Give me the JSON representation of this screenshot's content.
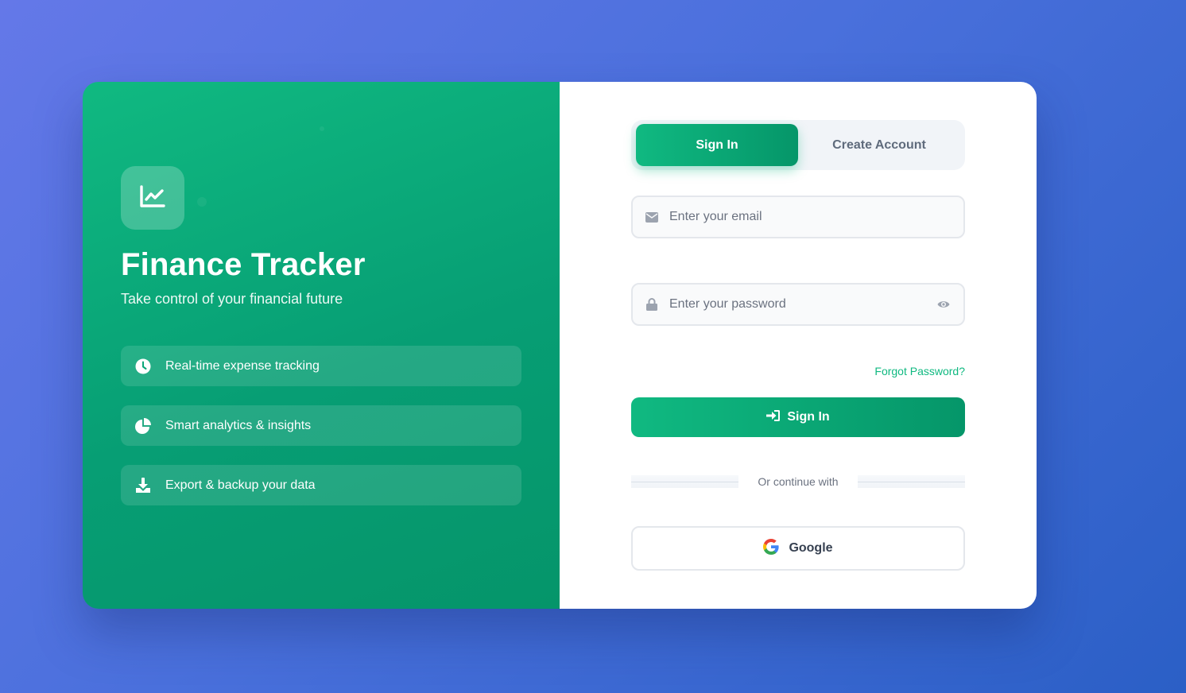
{
  "brand": {
    "title": "Finance Tracker",
    "subtitle": "Take control of your financial future",
    "logo_icon": "chart-line-icon"
  },
  "features": [
    {
      "label": "Real-time expense tracking",
      "icon": "clock-icon"
    },
    {
      "label": "Smart analytics & insights",
      "icon": "pie-chart-icon"
    },
    {
      "label": "Export & backup your data",
      "icon": "download-icon"
    }
  ],
  "auth_tabs": {
    "signin_label": "Sign In",
    "create_label": "Create Account",
    "active": "signin"
  },
  "form": {
    "email": {
      "placeholder": "Enter your email",
      "value": "",
      "icon": "envelope-icon"
    },
    "password": {
      "placeholder": "Enter your password",
      "value": "",
      "icon": "lock-icon",
      "toggle_icon": "eye-icon"
    },
    "forgot_label": "Forgot Password?",
    "submit_label": "Sign In",
    "submit_icon": "sign-in-icon",
    "divider_text": "Or continue with",
    "google_label": "Google"
  },
  "colors": {
    "accent": "#10b981",
    "accent_dark": "#059669",
    "background_start": "#6478e8",
    "background_end": "#2b5fc6"
  }
}
